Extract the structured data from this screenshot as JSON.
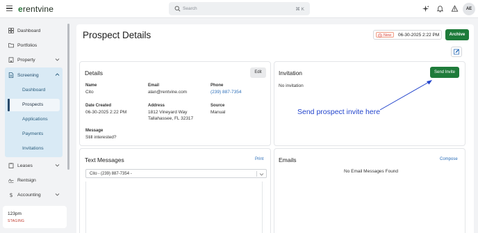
{
  "app": {
    "logo_text": "rentvine",
    "logo_letter": "e"
  },
  "search": {
    "placeholder": "Search",
    "shortcut": "⌘ K"
  },
  "user": {
    "initials": "AE"
  },
  "sidebar": {
    "items": [
      {
        "label": "Dashboard",
        "icon": "dashboard-icon"
      },
      {
        "label": "Portfolios",
        "icon": "folder-icon"
      },
      {
        "label": "Property",
        "icon": "building-icon"
      },
      {
        "label": "Screening",
        "icon": "document-icon"
      },
      {
        "label": "Leases",
        "icon": "clipboard-icon"
      },
      {
        "label": "Rentsign",
        "icon": "signature-icon"
      },
      {
        "label": "Accounting",
        "icon": "dollar-icon"
      }
    ],
    "screening_sub": [
      {
        "label": "Dashboard"
      },
      {
        "label": "Prospects"
      },
      {
        "label": "Applications"
      },
      {
        "label": "Payments"
      },
      {
        "label": "Invitations"
      }
    ],
    "active_sub": "Prospects",
    "org": {
      "name": "123pm",
      "env": "STAGING"
    }
  },
  "page": {
    "title": "Prospect Details",
    "status_badge": "New",
    "status_date": "06-30-2025 2:22 PM",
    "archive_label": "Archive"
  },
  "details": {
    "heading": "Details",
    "edit_label": "Edit",
    "name_label": "Name",
    "name_value": "Cito",
    "email_label": "Email",
    "email_value": "alan@rentvine.com",
    "phone_label": "Phone",
    "phone_value": "(239) 887-7354",
    "created_label": "Date Created",
    "created_value": "06-30-2025 2:22 PM",
    "address_label": "Address",
    "address_line1": "1812 Vineyard Way",
    "address_line2": "Tallahassee, FL 32317",
    "source_label": "Source",
    "source_value": "Manual",
    "message_label": "Message",
    "message_value": "Still interested?"
  },
  "invitation": {
    "heading": "Invitation",
    "send_label": "Send Invite",
    "empty_text": "No invitation",
    "annotation": "Send prospect invite here"
  },
  "text_messages": {
    "heading": "Text Messages",
    "print_label": "Print",
    "thread_value": "Cito - (239) 887-7354 -"
  },
  "emails": {
    "heading": "Emails",
    "compose_label": "Compose",
    "empty_text": "No Email Messages Found"
  },
  "colors": {
    "brand_green": "#1e7b3a",
    "link_blue": "#2a6db8",
    "annotation_blue": "#2244cc",
    "active_nav_bg": "#d9eaf5"
  }
}
